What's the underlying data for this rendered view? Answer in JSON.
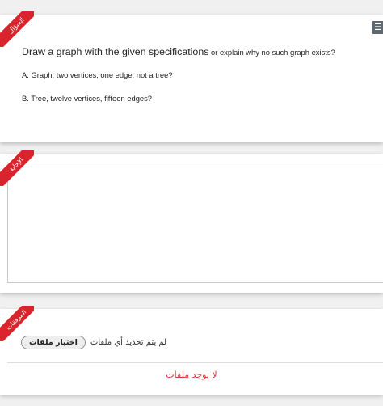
{
  "question": {
    "ribbon_label": "السؤال",
    "menu_icon": "menu-icon",
    "title_main": "Draw a graph with the given specifications",
    "title_sub": " or explain why no such graph exists?",
    "part_a": "A. Graph, two vertices, one edge, not a tree?",
    "part_b": "B. Tree, twelve vertices, fifteen edges?"
  },
  "answer": {
    "ribbon_label": "الإجابة",
    "value": ""
  },
  "attachments": {
    "ribbon_label": "المرفقات",
    "choose_button": "اختيار ملفات",
    "status_text": "لم يتم تحديد أي ملفات",
    "empty_message": "لا يوجد ملفات"
  },
  "colors": {
    "ribbon": "#d9242d",
    "empty_message": "#d23a3a"
  }
}
